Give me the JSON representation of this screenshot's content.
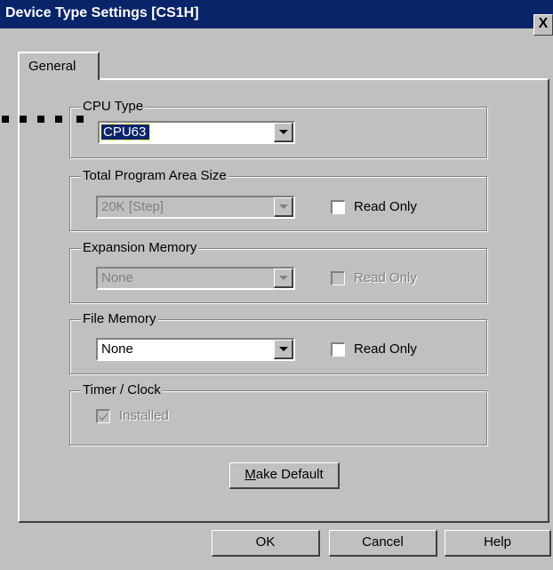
{
  "window": {
    "title": "Device Type Settings [CS1H]",
    "close_glyph": "X"
  },
  "tabs": [
    {
      "label": "General",
      "selected": true
    }
  ],
  "cpu_type": {
    "group_label": "CPU Type",
    "value": "CPU63"
  },
  "program_area": {
    "group_label": "Total Program Area Size",
    "value": "20K [Step]",
    "enabled": false,
    "read_only_label": "Read Only",
    "read_only_checked": false
  },
  "expansion_memory": {
    "group_label": "Expansion Memory",
    "value": "None",
    "enabled": false,
    "read_only_label": "Read Only",
    "read_only_checked": false
  },
  "file_memory": {
    "group_label": "File Memory",
    "value": "None",
    "enabled": true,
    "read_only_label": "Read Only",
    "read_only_checked": false
  },
  "timer_clock": {
    "group_label": "Timer / Clock",
    "installed_label": "Installed",
    "installed_checked": true,
    "enabled": false
  },
  "make_default": {
    "label_mnemonic": "M",
    "label_rest": "ake Default"
  },
  "footer_buttons": {
    "ok": "OK",
    "cancel": "Cancel",
    "help": "Help"
  },
  "colors": {
    "titlebar": "#0a246a",
    "face": "#c0c0c0",
    "selection": "#0a246a"
  },
  "icons": {
    "close": "close-icon",
    "dropdown": "chevron-down-icon",
    "check": "checkmark-icon"
  }
}
